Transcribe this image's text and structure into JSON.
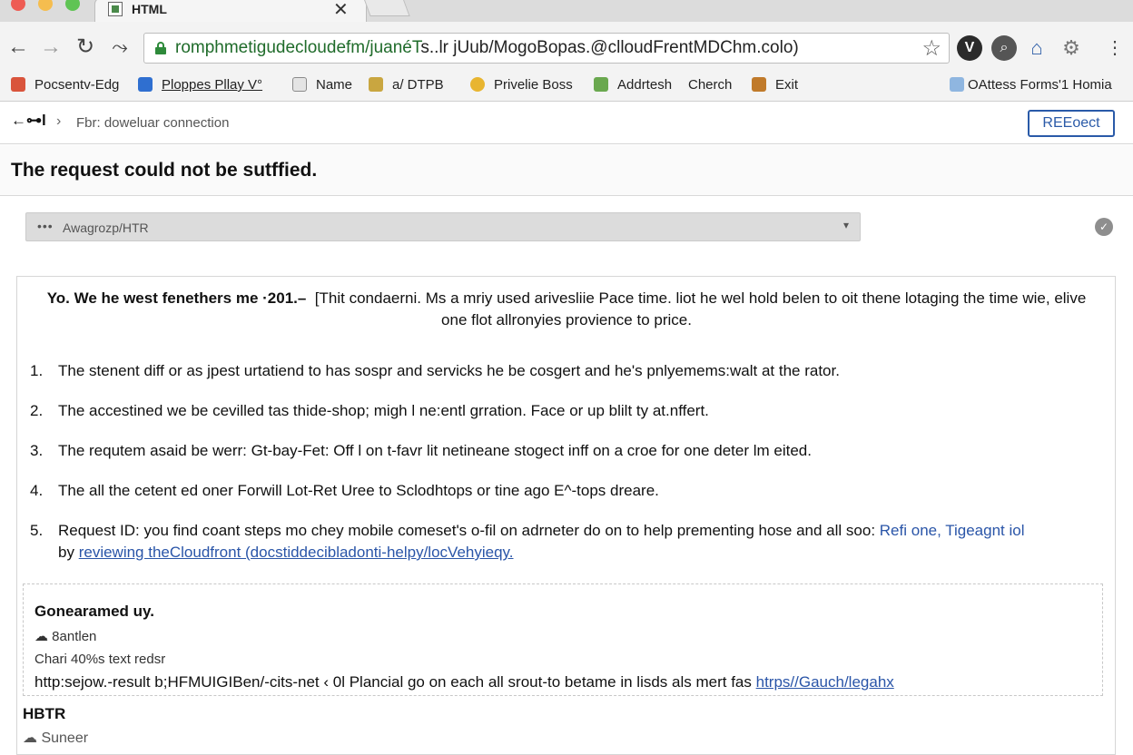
{
  "tab": {
    "title": "HTML",
    "close": "✕"
  },
  "toolbar": {
    "url_host": "romphmetigudecloudefm/juanéT",
    "url_rest": "s..lr jUub/MogoBopas.@clloudFrentMDChm.colo)"
  },
  "bookmarks": [
    {
      "label": "Pocsentv-Edg",
      "color": "#d9543c"
    },
    {
      "label": "Ploppes Pllay V°",
      "color": "#2f6fd0"
    },
    {
      "label": "Name",
      "color": "#8a8a8a"
    },
    {
      "label": "a/ DTPB",
      "color": "#c9a640"
    },
    {
      "label": "Privelie Boss",
      "color": "#e8b530"
    },
    {
      "label": "Addrtesh",
      "color": "#6aa84f"
    },
    {
      "label": "Cherch",
      "color": ""
    },
    {
      "label": "Exit",
      "color": "#c07a2a"
    },
    {
      "label": "OAttess Forms'1 Homia",
      "color": "#8fb6e0"
    }
  ],
  "breadcrumb": {
    "back": "←⊶l",
    "separator": "›",
    "text": "Fbr: doweluar connection",
    "action": "REEoect"
  },
  "page": {
    "title": "The request could not be sutffied."
  },
  "select": {
    "dots": "•••",
    "value": "Awagrozp/HTR",
    "caret": "▾"
  },
  "content": {
    "intro_bold": "Yo. We he west fenethers me ·201.–",
    "intro_rest": "[Thit condaerni. Ms a mriy used arivesliie Pace time. liot he wel hold belen to oit thene lotaging the time wie, elive one flot allronyies provience to price.",
    "steps": [
      {
        "num": "1.",
        "text": "The stenent diff or as jpest urtatiend to has sospr and servicks he be cosgert and he's pnlyemems:walt at the rator."
      },
      {
        "num": "2.",
        "text": "The accestined we be cevilled tas thide-shop; migh l ne:entl grration. Face or up blilt ty at.nffert."
      },
      {
        "num": "3.",
        "text": "The requtem asaid be werr: Gt-bay-Fet: Off l on t-favr lit netineane stogect inff on a croe for one deter lm eited."
      },
      {
        "num": "4.",
        "text": "The all the cetent ed oner Forwill Lot-Ret Uree to Sclodhtops or tine ago E^-tops dreare."
      }
    ],
    "step5": {
      "num": "5.",
      "text": "Request ID: you find coant steps mo chey mobile comeset's o-fil on adrneter do on to help prementing hose and all soo:",
      "link_inline": "Refi one, Tigeagnt iol",
      "prefix2": "by",
      "link": "reviewing theCloudfront (docstiddecibladonti-helpy/locVehyieqy."
    }
  },
  "generated": {
    "title": "Gonearamed uy.",
    "line1": "8antlen",
    "line2": "Chari 40%s text redsr",
    "line3": "http:sejow.-result b;HFMUIGIBen/-cits-net ‹ 0l Plancial go on each all srout-to betame in lisds als mert fas",
    "line3_link": "htrps//Gauch/legahx"
  },
  "footer": {
    "title": "HBTR",
    "sub": "Suneer"
  }
}
